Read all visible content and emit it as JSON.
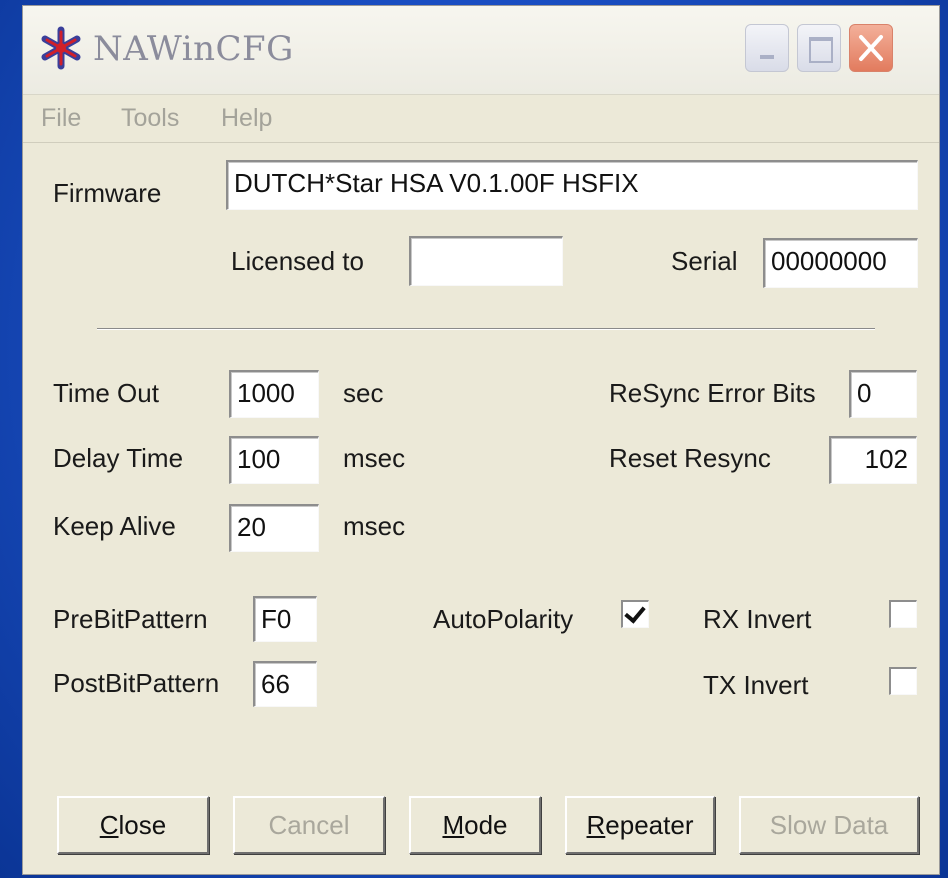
{
  "window": {
    "title": "NAWinCFG",
    "icon": "asterisk-star-icon",
    "controls": [
      "minimize",
      "maximize",
      "close"
    ]
  },
  "menu": [
    "File",
    "Tools",
    "Help"
  ],
  "firmware": {
    "label": "Firmware",
    "value": "DUTCH*Star HSA V0.1.00F HSFIX"
  },
  "license": {
    "label": "Licensed to",
    "value": ""
  },
  "serial": {
    "label": "Serial",
    "value": "00000000"
  },
  "timing": {
    "time_out": {
      "label": "Time Out",
      "value": "1000",
      "unit": "sec"
    },
    "delay_time": {
      "label": "Delay Time",
      "value": "100",
      "unit": "msec"
    },
    "keep_alive": {
      "label": "Keep Alive",
      "value": "20",
      "unit": "msec"
    }
  },
  "resync": {
    "error_bits": {
      "label": "ReSync Error Bits",
      "value": "0"
    },
    "reset": {
      "label": "Reset Resync",
      "value": "102"
    }
  },
  "patterns": {
    "pre": {
      "label": "PreBitPattern",
      "value": "F0"
    },
    "post": {
      "label": "PostBitPattern",
      "value": "66"
    }
  },
  "options": {
    "auto_polarity": {
      "label": "AutoPolarity",
      "checked": true
    },
    "rx_invert": {
      "label": "RX Invert",
      "checked": false
    },
    "tx_invert": {
      "label": "TX Invert",
      "checked": false
    }
  },
  "buttons": {
    "close": {
      "mnemonic": "C",
      "rest": "lose",
      "enabled": true
    },
    "cancel": {
      "label": "Cancel",
      "enabled": false
    },
    "mode": {
      "mnemonic": "M",
      "rest": "ode",
      "enabled": true
    },
    "repeater": {
      "mnemonic": "R",
      "rest": "epeater",
      "enabled": true
    },
    "slow_data": {
      "label": "Slow Data",
      "enabled": false
    }
  },
  "colors": {
    "desktop": "#1a4fc4",
    "window_face": "#ece9d8",
    "close_button": "#e27b5e",
    "disabled_text": "#a9a79c"
  }
}
